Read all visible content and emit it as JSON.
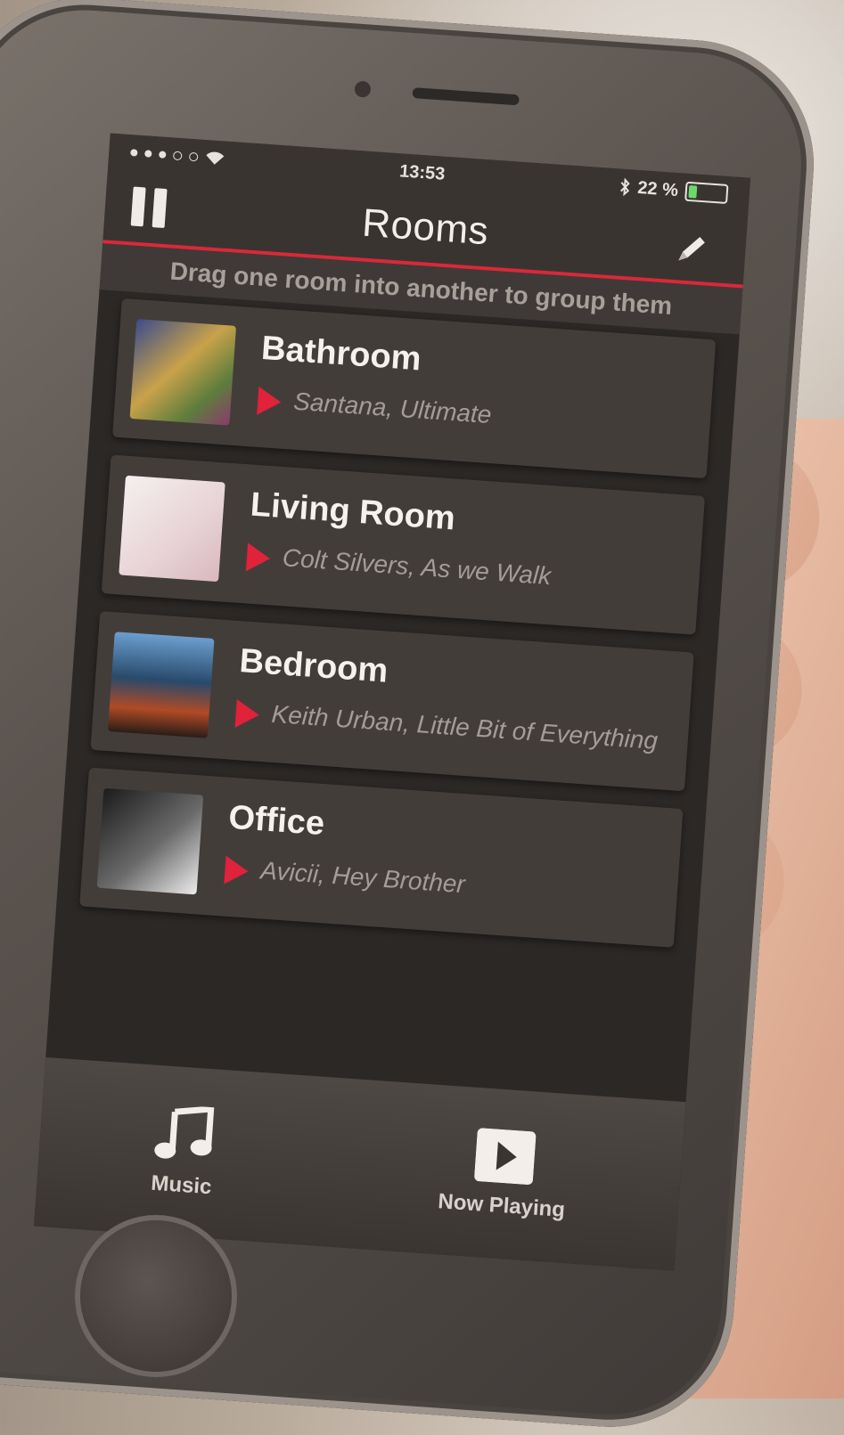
{
  "status_bar": {
    "time": "13:53",
    "battery_percent": "22 %",
    "battery_level": 0.22
  },
  "header": {
    "title": "Rooms",
    "pause_icon": "pause-icon",
    "edit_icon": "pencil-icon"
  },
  "hint": "Drag one room into another to group them",
  "rooms": [
    {
      "name": "Bathroom",
      "track": "Santana, Ultimate"
    },
    {
      "name": "Living Room",
      "track": "Colt Silvers, As we Walk"
    },
    {
      "name": "Bedroom",
      "track": "Keith Urban, Little Bit of Everything"
    },
    {
      "name": "Office",
      "track": "Avicii, Hey Brother"
    }
  ],
  "tabbar": {
    "music_label": "Music",
    "now_playing_label": "Now Playing",
    "music_icon": "music-note-icon",
    "now_playing_icon": "play-icon"
  },
  "colors": {
    "accent": "#d8293a",
    "screen_bg": "#2c2826"
  }
}
